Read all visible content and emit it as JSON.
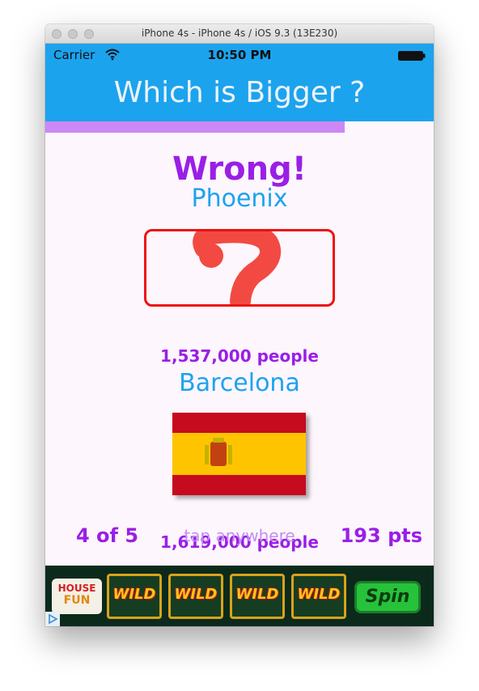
{
  "window": {
    "title": "iPhone 4s - iPhone 4s / iOS 9.3 (13E230)"
  },
  "statusbar": {
    "carrier": "Carrier",
    "time": "10:50 PM",
    "icons": [
      "wifi-icon",
      "battery-icon"
    ]
  },
  "header": {
    "title": "Which is Bigger ?"
  },
  "progress": {
    "value": 0.77,
    "color": "#cc88f4"
  },
  "result": {
    "text": "Wrong!"
  },
  "city1": {
    "name": "Phoenix",
    "population": "1,537,000 people",
    "image": "question-mark-icon"
  },
  "city2": {
    "name": "Barcelona",
    "population": "1,619,000 people",
    "image": "spain-flag-icon"
  },
  "footer": {
    "counter": "4 of 5",
    "hint": "tap anywhere",
    "score": "193 pts"
  },
  "ad": {
    "logo_line1": "HOUSE",
    "logo_line2": "FUN",
    "reels": [
      "WILD",
      "WILD",
      "WILD",
      "WILD"
    ],
    "spin_label": "Spin"
  },
  "colors": {
    "header_blue": "#1ca3ee",
    "purple": "#9a1fe6",
    "red_border": "#ee1111",
    "background": "#fdf6fd"
  }
}
